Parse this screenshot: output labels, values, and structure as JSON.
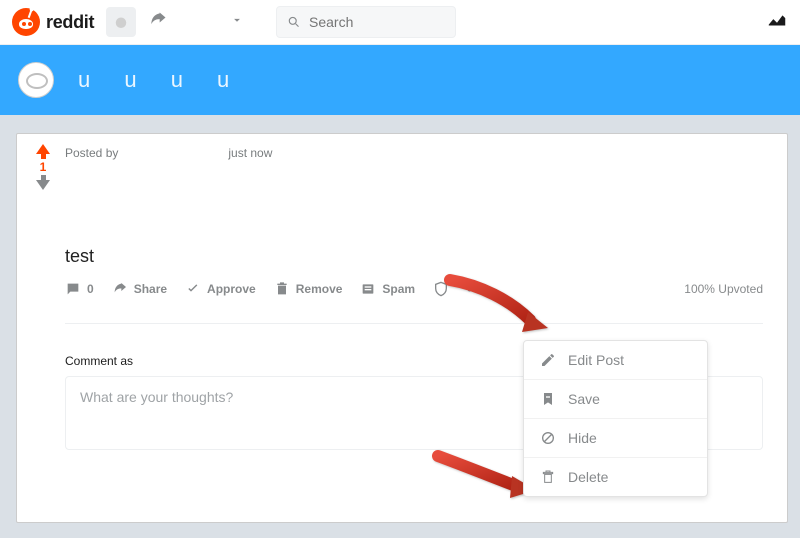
{
  "brand": {
    "name": "reddit"
  },
  "search": {
    "placeholder": "Search"
  },
  "banner": {
    "scribble": "u   u  u u"
  },
  "post": {
    "score": "1",
    "posted_by_prefix": "Posted by",
    "posted_time": "just now",
    "title": "test",
    "comment_count": "0",
    "upvoted_text": "100% Upvoted"
  },
  "actions": {
    "share": "Share",
    "approve": "Approve",
    "remove": "Remove",
    "spam": "Spam"
  },
  "comment": {
    "label": "Comment as",
    "placeholder": "What are your thoughts?"
  },
  "menu": {
    "edit": "Edit Post",
    "save": "Save",
    "hide": "Hide",
    "delete": "Delete"
  }
}
